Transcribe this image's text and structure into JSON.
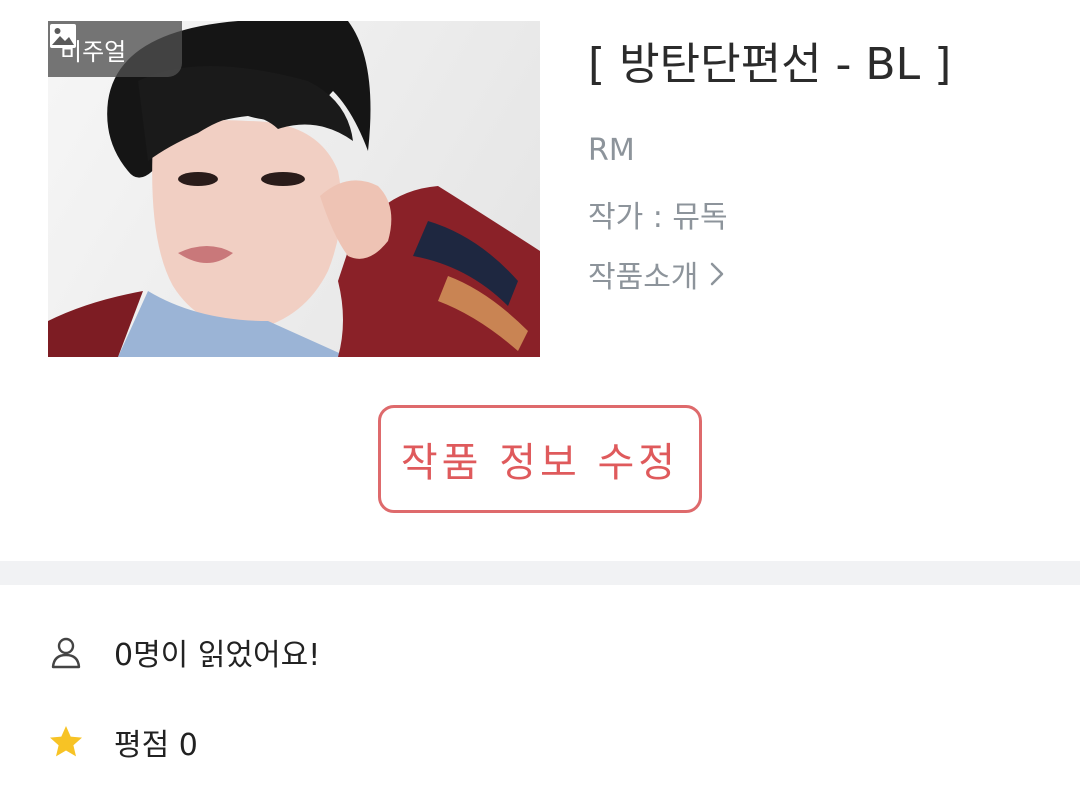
{
  "cover": {
    "badge_label": "비주얼",
    "badge_icon": "image-icon"
  },
  "work": {
    "title": "[ 방탄단편선 - BL ]",
    "publisher": "RM",
    "author": "작가 : 뮤독",
    "intro_label": "작품소개",
    "intro_icon": "chevron-right-icon"
  },
  "actions": {
    "edit_label": "작품 정보 수정"
  },
  "stats": {
    "readers_text": "0명이 읽었어요!",
    "readers_icon": "person-icon",
    "rating_text": "평점 0",
    "rating_icon": "star-icon"
  },
  "colors": {
    "accent": "#df5a5c",
    "muted_text": "#8d949b",
    "star": "#f7c325",
    "divider": "#f1f2f4"
  }
}
